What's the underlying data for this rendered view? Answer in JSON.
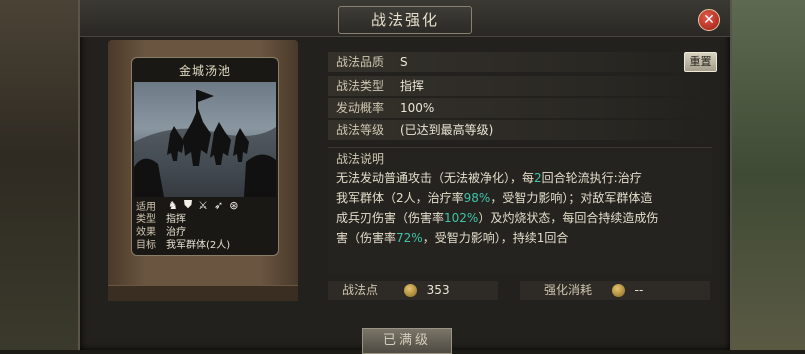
{
  "dialog": {
    "title": "战法强化",
    "close_label": "✕"
  },
  "card": {
    "name": "金城汤池",
    "icons_label": "适用",
    "icons": [
      "horse-icon",
      "shield-icon",
      "crossed-swords-icon",
      "spear-icon",
      "wheel-icon"
    ],
    "type_label": "类型",
    "type_value": "指挥",
    "effect_label": "效果",
    "effect_value": "治疗",
    "target_label": "目标",
    "target_value": "我军群体(2人)"
  },
  "info": {
    "quality_label": "战法品质",
    "quality_value": "S",
    "type_label": "战法类型",
    "type_value": "指挥",
    "chance_label": "发动概率",
    "chance_value": "100%",
    "level_label": "战法等级",
    "level_value": "(已达到最高等级)",
    "reset_label": "重置"
  },
  "description": {
    "title": "战法说明",
    "line1": "无法发动普通攻击（无法被净化），每",
    "line1_hl": "2",
    "line1_end": "回合轮流执行:治疗",
    "line2": "我军群体（2人，治疗率",
    "line2_hl": "98%",
    "line2_end": "，受智力影响）；对敌军群体造",
    "line3": "成兵刃伤害（伤害率",
    "line3_hl": "102%",
    "line3_end": "）及灼烧状态，每回合持续造成伤",
    "line4": "害（伤害率",
    "line4_hl": "72%",
    "line4_end": "，受智力影响），持续1回合",
    "highlight_color": "#3fc4a8"
  },
  "stats": {
    "points_label": "战法点",
    "points_value": "353",
    "cost_label": "强化消耗",
    "cost_value": "--"
  },
  "bottom_button": {
    "label": "已满级"
  }
}
